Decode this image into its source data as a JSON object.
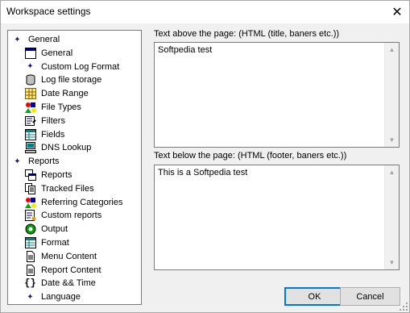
{
  "window": {
    "title": "Workspace settings"
  },
  "tree": {
    "items": [
      {
        "label": "General",
        "icon": "diamond-icon",
        "level": 0
      },
      {
        "label": "General",
        "icon": "window-icon",
        "level": 1
      },
      {
        "label": "Custom Log Format",
        "icon": "diamond-icon",
        "level": 1
      },
      {
        "label": "Log file storage",
        "icon": "database-icon",
        "level": 1
      },
      {
        "label": "Date Range",
        "icon": "calendar-icon",
        "level": 1
      },
      {
        "label": "File Types",
        "icon": "shapes-icon",
        "level": 1
      },
      {
        "label": "Filters",
        "icon": "filter-icon",
        "level": 1
      },
      {
        "label": "Fields",
        "icon": "grid-icon",
        "level": 1
      },
      {
        "label": "DNS Lookup",
        "icon": "computer-icon",
        "level": 1
      },
      {
        "label": "Reports",
        "icon": "diamond-icon",
        "level": 0
      },
      {
        "label": "Reports",
        "icon": "windows-icon",
        "level": 1
      },
      {
        "label": "Tracked Files",
        "icon": "files-icon",
        "level": 1
      },
      {
        "label": "Referring Categories",
        "icon": "shapes-icon",
        "level": 1
      },
      {
        "label": "Custom reports",
        "icon": "custom-report-icon",
        "level": 1
      },
      {
        "label": "Output",
        "icon": "output-icon",
        "level": 1
      },
      {
        "label": "Format",
        "icon": "grid-icon",
        "level": 1
      },
      {
        "label": "Menu Content",
        "icon": "document-icon",
        "level": 1
      },
      {
        "label": "Report Content",
        "icon": "document-icon",
        "level": 1
      },
      {
        "label": "Date && Time",
        "icon": "braces-icon",
        "level": 1
      },
      {
        "label": "Language",
        "icon": "diamond-icon",
        "level": 1
      }
    ]
  },
  "above": {
    "label": "Text above the page: (HTML (title, baners etc.))",
    "value": "Softpedia test"
  },
  "below": {
    "label": "Text below the page: (HTML (footer, baners etc.))",
    "value": "This is a Softpedia test"
  },
  "buttons": {
    "ok": "OK",
    "cancel": "Cancel"
  },
  "colors": {
    "accent": "#0078d7",
    "diamond": "#1c1c78"
  }
}
